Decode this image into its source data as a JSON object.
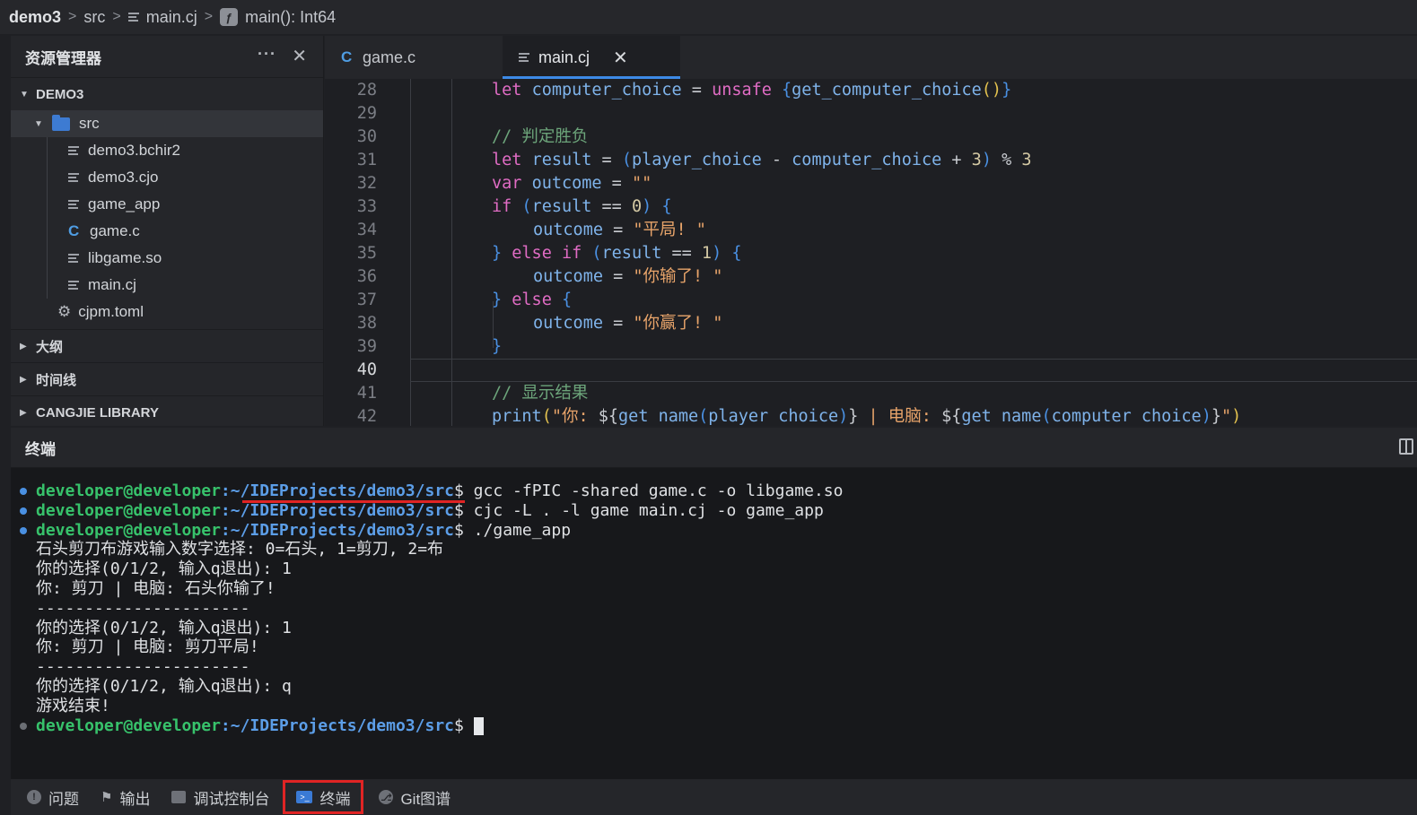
{
  "breadcrumb": {
    "project": "demo3",
    "folder": "src",
    "file": "main.cj",
    "symbol": "main(): Int64",
    "separator": ">"
  },
  "sidebar": {
    "title": "资源管理器",
    "more": "···",
    "close": "✕",
    "root": "DEMO3",
    "folder": "src",
    "files": [
      {
        "name": "demo3.bchir2",
        "icon": "lines-icon"
      },
      {
        "name": "demo3.cjo",
        "icon": "lines-icon"
      },
      {
        "name": "game_app",
        "icon": "lines-icon"
      },
      {
        "name": "game.c",
        "icon": "c-icon"
      },
      {
        "name": "libgame.so",
        "icon": "lines-icon"
      },
      {
        "name": "main.cj",
        "icon": "lines-icon"
      }
    ],
    "config_file": "cjpm.toml",
    "sections": [
      "大纲",
      "时间线",
      "CANGJIE LIBRARY"
    ]
  },
  "editor": {
    "tabs": [
      {
        "label": "game.c",
        "icon": "c-icon",
        "active": false
      },
      {
        "label": "main.cj",
        "icon": "lines-icon",
        "active": true,
        "close": "✕"
      }
    ],
    "current_line": 40,
    "lines": [
      {
        "n": "28",
        "indent": 4,
        "tokens": [
          [
            "kw",
            "let "
          ],
          [
            "id",
            "computer_choice"
          ],
          [
            "op",
            " = "
          ],
          [
            "kw",
            "unsafe "
          ],
          [
            "br2",
            "{"
          ],
          [
            "id",
            "get_computer_choice"
          ],
          [
            "br1",
            "()"
          ],
          [
            "br2",
            "}"
          ]
        ]
      },
      {
        "n": "29",
        "indent": 4,
        "tokens": []
      },
      {
        "n": "30",
        "indent": 4,
        "tokens": [
          [
            "cm",
            "// 判定胜负"
          ]
        ]
      },
      {
        "n": "31",
        "indent": 4,
        "tokens": [
          [
            "kw",
            "let "
          ],
          [
            "id",
            "result"
          ],
          [
            "op",
            " = "
          ],
          [
            "br2",
            "("
          ],
          [
            "id",
            "player_choice"
          ],
          [
            "op",
            " - "
          ],
          [
            "id",
            "computer_choice"
          ],
          [
            "op",
            " + "
          ],
          [
            "num",
            "3"
          ],
          [
            "br2",
            ")"
          ],
          [
            "op",
            " % "
          ],
          [
            "num",
            "3"
          ]
        ]
      },
      {
        "n": "32",
        "indent": 4,
        "tokens": [
          [
            "kw",
            "var "
          ],
          [
            "id",
            "outcome"
          ],
          [
            "op",
            " = "
          ],
          [
            "str",
            "\"\""
          ]
        ]
      },
      {
        "n": "33",
        "indent": 4,
        "tokens": [
          [
            "kw",
            "if "
          ],
          [
            "br2",
            "("
          ],
          [
            "id",
            "result"
          ],
          [
            "op",
            " == "
          ],
          [
            "num",
            "0"
          ],
          [
            "br2",
            ")"
          ],
          [
            "op",
            " "
          ],
          [
            "br2",
            "{"
          ]
        ]
      },
      {
        "n": "34",
        "indent": 8,
        "tokens": [
          [
            "id",
            "outcome"
          ],
          [
            "op",
            " = "
          ],
          [
            "str",
            "\"平局! \""
          ]
        ]
      },
      {
        "n": "35",
        "indent": 4,
        "tokens": [
          [
            "br2",
            "}"
          ],
          [
            "kw",
            " else if "
          ],
          [
            "br2",
            "("
          ],
          [
            "id",
            "result"
          ],
          [
            "op",
            " == "
          ],
          [
            "num",
            "1"
          ],
          [
            "br2",
            ")"
          ],
          [
            "op",
            " "
          ],
          [
            "br2",
            "{"
          ]
        ]
      },
      {
        "n": "36",
        "indent": 8,
        "tokens": [
          [
            "id",
            "outcome"
          ],
          [
            "op",
            " = "
          ],
          [
            "str",
            "\"你输了! \""
          ]
        ]
      },
      {
        "n": "37",
        "indent": 4,
        "tokens": [
          [
            "br2",
            "}"
          ],
          [
            "kw",
            " else "
          ],
          [
            "br2",
            "{"
          ]
        ]
      },
      {
        "n": "38",
        "indent": 8,
        "tokens": [
          [
            "id",
            "outcome"
          ],
          [
            "op",
            " = "
          ],
          [
            "str",
            "\"你赢了! \""
          ]
        ]
      },
      {
        "n": "39",
        "indent": 4,
        "tokens": [
          [
            "br2",
            "}"
          ]
        ]
      },
      {
        "n": "40",
        "indent": 4,
        "tokens": []
      },
      {
        "n": "41",
        "indent": 4,
        "tokens": [
          [
            "cm",
            "// 显示结果"
          ]
        ]
      },
      {
        "n": "42",
        "indent": 4,
        "tokens": [
          [
            "id",
            "print"
          ],
          [
            "br1",
            "("
          ],
          [
            "str",
            "\"你: "
          ],
          [
            "op",
            "${"
          ],
          [
            "id",
            "get name"
          ],
          [
            "br2",
            "("
          ],
          [
            "id",
            "player choice"
          ],
          [
            "br2",
            ")"
          ],
          [
            "op",
            "}"
          ],
          [
            "str",
            " | 电脑: "
          ],
          [
            "op",
            "${"
          ],
          [
            "id",
            "get name"
          ],
          [
            "br2",
            "("
          ],
          [
            "id",
            "computer choice"
          ],
          [
            "br2",
            ")"
          ],
          [
            "op",
            "}"
          ],
          [
            "str",
            "\""
          ],
          [
            "br1",
            ")"
          ]
        ]
      }
    ]
  },
  "terminal": {
    "title": "终端",
    "user": "developer@developer",
    "path": ":~/IDEProjects/demo3/src",
    "prompt": "$",
    "commands": [
      " gcc -fPIC -shared game.c -o libgame.so",
      " cjc -L . -l game main.cj -o game_app",
      " ./game_app"
    ],
    "output": [
      "石头剪刀布游戏输入数字选择: 0=石头, 1=剪刀, 2=布",
      "你的选择(0/1/2, 输入q退出): 1",
      "你: 剪刀 | 电脑: 石头你输了!",
      "----------------------",
      "你的选择(0/1/2, 输入q退出): 1",
      "你: 剪刀 | 电脑: 剪刀平局!",
      "----------------------",
      "你的选择(0/1/2, 输入q退出): q",
      "游戏结束!"
    ],
    "final_prompt_input": " "
  },
  "panelbar": {
    "items": [
      {
        "label": "问题",
        "icon": "info-circle-icon"
      },
      {
        "label": "输出",
        "icon": "flag-icon"
      },
      {
        "label": "调试控制台",
        "icon": "debug-console-icon"
      },
      {
        "label": "终端",
        "icon": "terminal-icon",
        "active": true
      },
      {
        "label": "Git图谱",
        "icon": "git-graph-icon"
      }
    ]
  },
  "colors": {
    "accent": "#3d8ae6",
    "highlight_box": "#e02424",
    "terminal_user": "#37c26b",
    "terminal_path": "#5c9ee8"
  }
}
